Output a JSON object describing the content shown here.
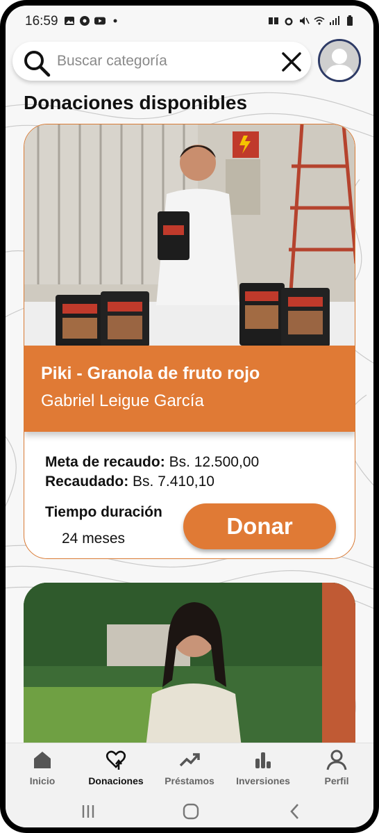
{
  "status_bar": {
    "time": "16:59"
  },
  "search": {
    "placeholder": "Buscar categoría"
  },
  "page": {
    "title": "Donaciones disponibles"
  },
  "donations": [
    {
      "title": "Piki - Granola de fruto rojo",
      "author": "Gabriel Leigue García",
      "goal_label": "Meta de recaudo:",
      "goal_value": "Bs. 12.500,00",
      "raised_label": "Recaudado:",
      "raised_value": "Bs. 7.410,10",
      "duration_label": "Tiempo duración",
      "duration_value": "24 meses",
      "button_label": "Donar",
      "photo": "person-with-granola-packages-photo"
    },
    {
      "photo": "woman-in-garden-photo"
    }
  ],
  "bottom_nav": [
    {
      "label": "Inicio",
      "icon": "home-icon",
      "active": false
    },
    {
      "label": "Donaciones",
      "icon": "donation-heart-icon",
      "active": true
    },
    {
      "label": "Préstamos",
      "icon": "trend-up-icon",
      "active": false
    },
    {
      "label": "Inversiones",
      "icon": "bar-chart-icon",
      "active": false
    },
    {
      "label": "Perfil",
      "icon": "person-icon",
      "active": false
    }
  ],
  "colors": {
    "accent": "#e07a35",
    "avatar_border": "#2e3b66"
  }
}
